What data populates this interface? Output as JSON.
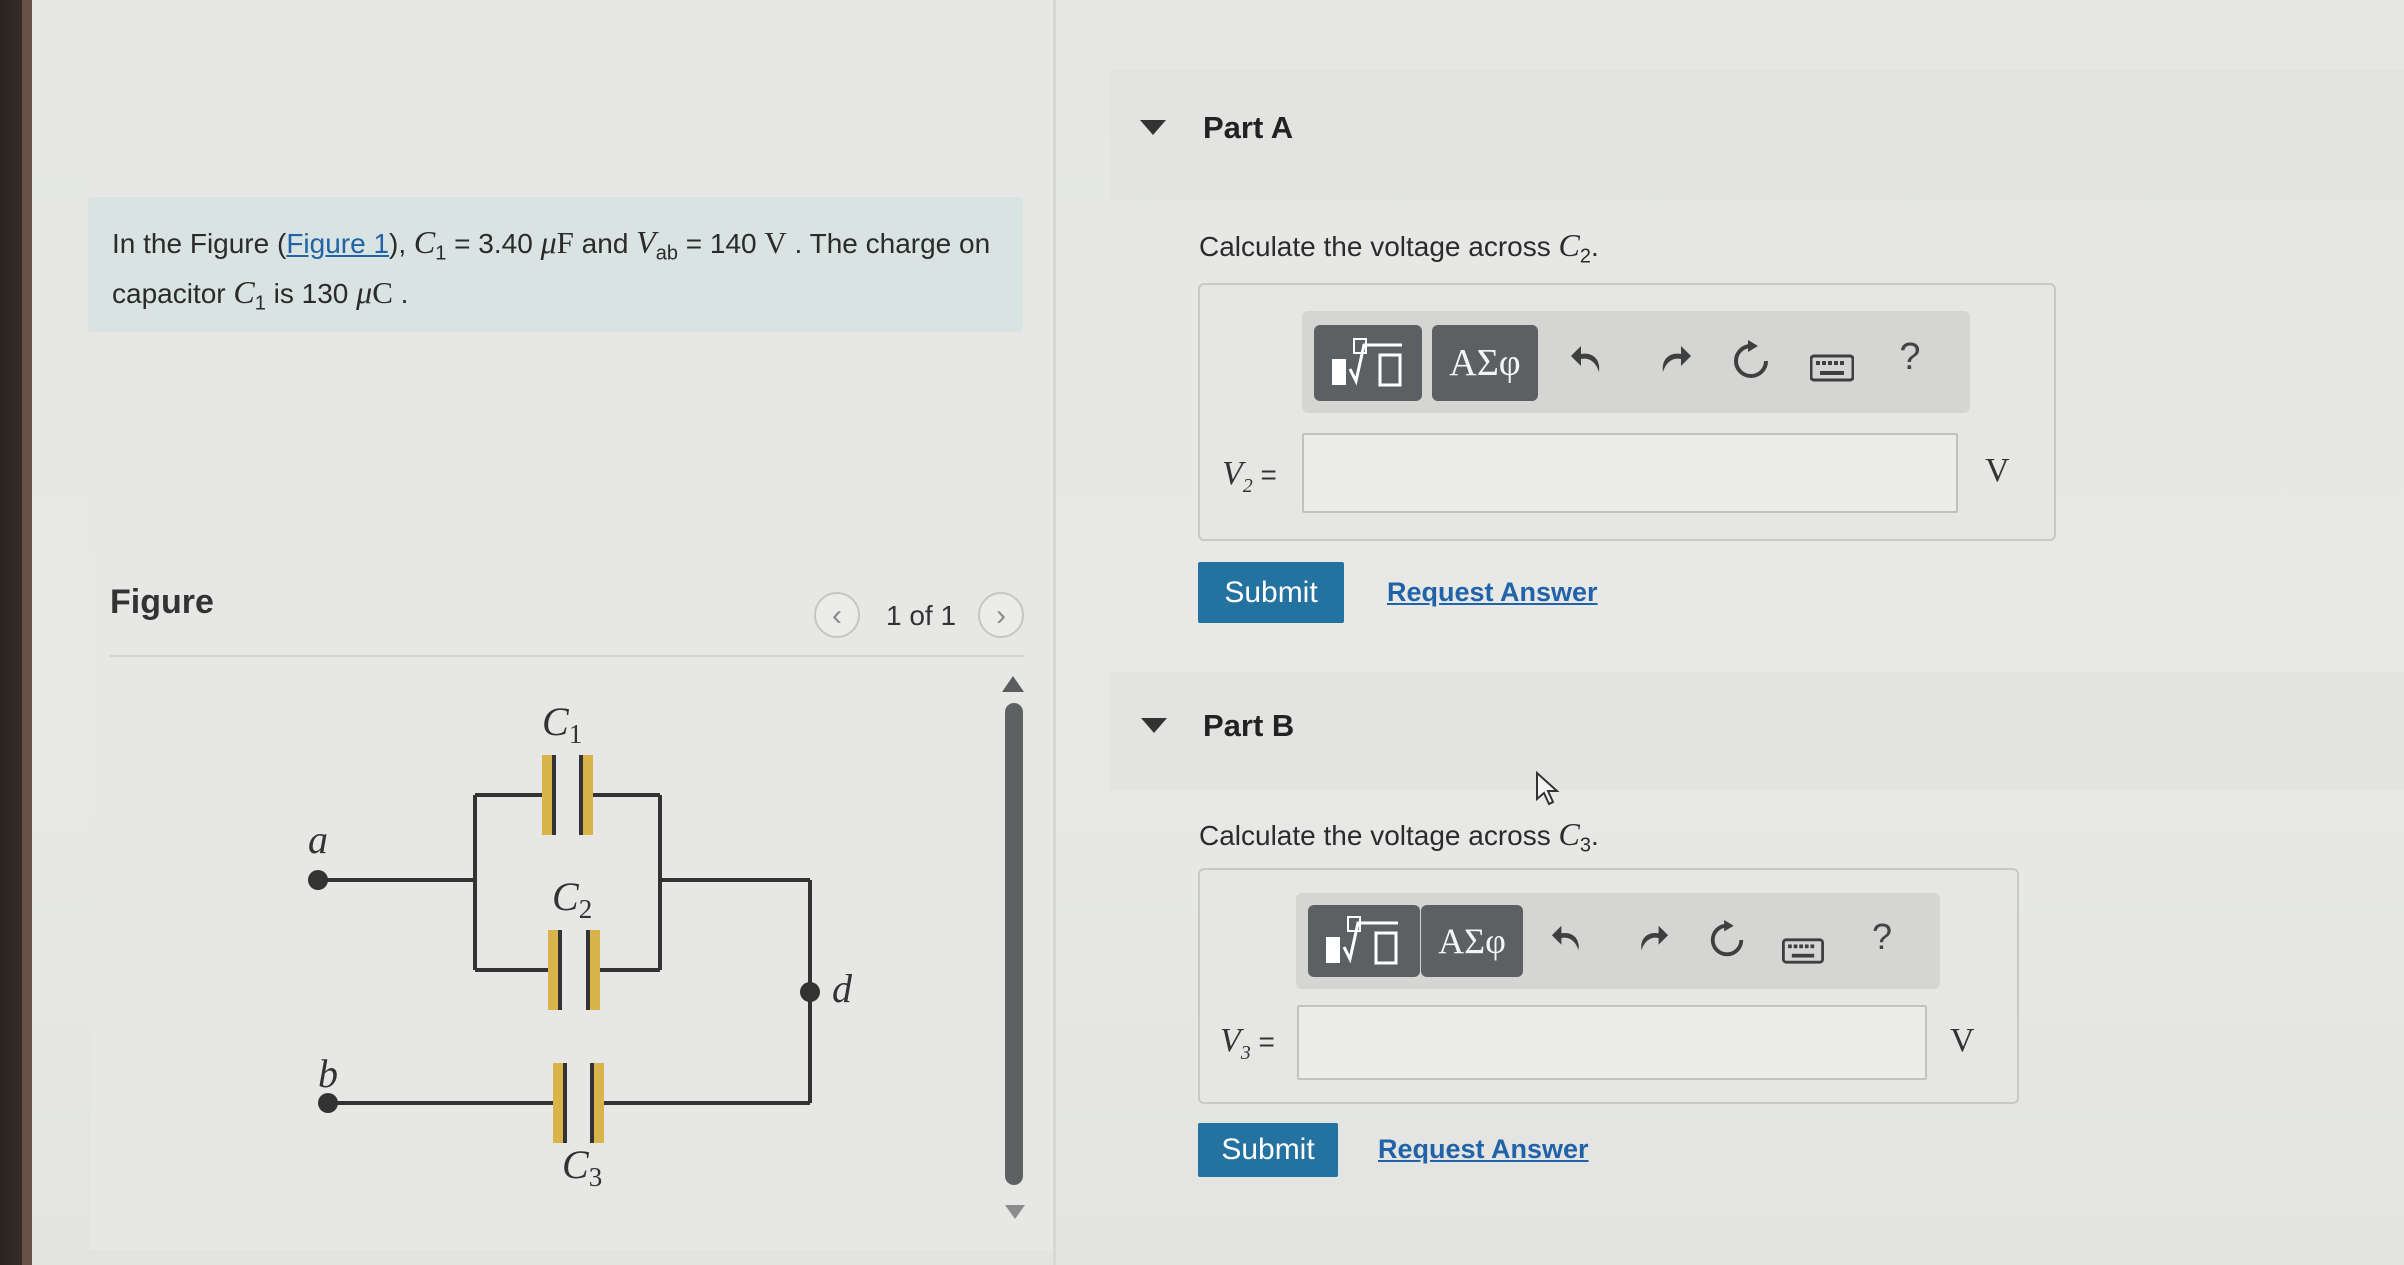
{
  "problem": {
    "t_intro": "In the Figure (",
    "figure_link": "Figure 1",
    "t_after_link": "), ",
    "c1_symbol": "C",
    "c1_sub": "1",
    "c1_eq": " = 3.40 ",
    "mu1": "μ",
    "c1_unit": "F",
    "t_and": " and ",
    "vab_symbol": "V",
    "vab_sub": "ab",
    "vab_eq": " = 140 ",
    "vab_unit": "V",
    "t_charge": " . The charge on capacitor ",
    "c1b_symbol": "C",
    "c1b_sub": "1",
    "t_is": " is 130 ",
    "mu2": "μ",
    "q_unit": "C",
    "t_end": " ."
  },
  "figure_panel": {
    "label": "Figure",
    "prev_icon": "‹",
    "next_icon": "›",
    "page_count": "1 of 1"
  },
  "circuit": {
    "node_a": "a",
    "node_b": "b",
    "node_d": "d",
    "c_symbol": "C",
    "c1_sub": "1",
    "c2_sub": "2",
    "c3_sub": "3"
  },
  "part_a": {
    "title": "Part A",
    "question_prefix": "Calculate the voltage across ",
    "q_symbol": "C",
    "q_sub": "2",
    "q_suffix": ".",
    "var_symbol": "V",
    "var_sub": "2",
    "var_eq": " =",
    "unit": "V",
    "submit_label": "Submit",
    "request_label": "Request Answer"
  },
  "part_b": {
    "title": "Part B",
    "question_prefix": "Calculate the voltage across ",
    "q_symbol": "C",
    "q_sub": "3",
    "q_suffix": ".",
    "var_symbol": "V",
    "var_sub": "3",
    "var_eq": " =",
    "unit": "V",
    "submit_label": "Submit",
    "request_label": "Request Answer"
  },
  "toolbar": {
    "greek_label": "ΑΣφ",
    "help_label": "?",
    "icons": [
      "templates-icon",
      "greek-symbols-icon",
      "undo-icon",
      "redo-icon",
      "reset-icon",
      "keyboard-icon",
      "help-icon"
    ]
  },
  "colors": {
    "accent": "#23729f",
    "link": "#2163a8",
    "problem_bg": "#d8e3e2",
    "capacitor_plate": "#d8b44a"
  }
}
